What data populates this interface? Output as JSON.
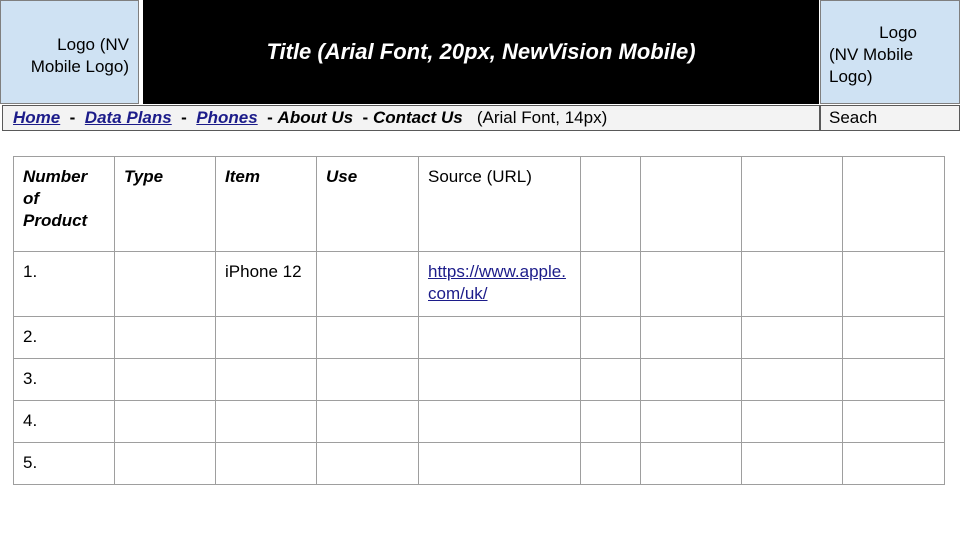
{
  "header": {
    "logo_left": "Logo (NV Mobile Logo)",
    "title": "Title (Arial Font, 20px, NewVision Mobile)",
    "logo_right_line1": "Logo",
    "logo_right_line2": "(NV Mobile Logo)"
  },
  "nav": {
    "items": [
      {
        "label": "Home"
      },
      {
        "label": "Data Plans"
      },
      {
        "label": "Phones"
      },
      {
        "label": "About Us"
      },
      {
        "label": "Contact Us"
      }
    ],
    "note": "(Arial Font, 14px)",
    "search_label": "Seach"
  },
  "table": {
    "headers": [
      "Number of Product",
      "Type",
      "Item",
      "Use",
      "Source (URL)",
      "",
      "",
      "",
      ""
    ],
    "rows": [
      [
        "1.",
        "",
        "iPhone 12",
        "",
        "https://www.apple.com/uk/",
        "",
        "",
        "",
        ""
      ],
      [
        "2.",
        "",
        "",
        "",
        "",
        "",
        "",
        "",
        ""
      ],
      [
        "3.",
        "",
        "",
        "",
        "",
        "",
        "",
        "",
        ""
      ],
      [
        "4.",
        "",
        "",
        "",
        "",
        "",
        "",
        "",
        ""
      ],
      [
        "5.",
        "",
        "",
        "",
        "",
        "",
        "",
        "",
        ""
      ]
    ]
  },
  "colors": {
    "logo_background": "#cfe2f3",
    "title_background": "#000000",
    "title_text": "#ffffff",
    "nav_background": "#f3f3f3",
    "link": "#1c1c8a"
  }
}
